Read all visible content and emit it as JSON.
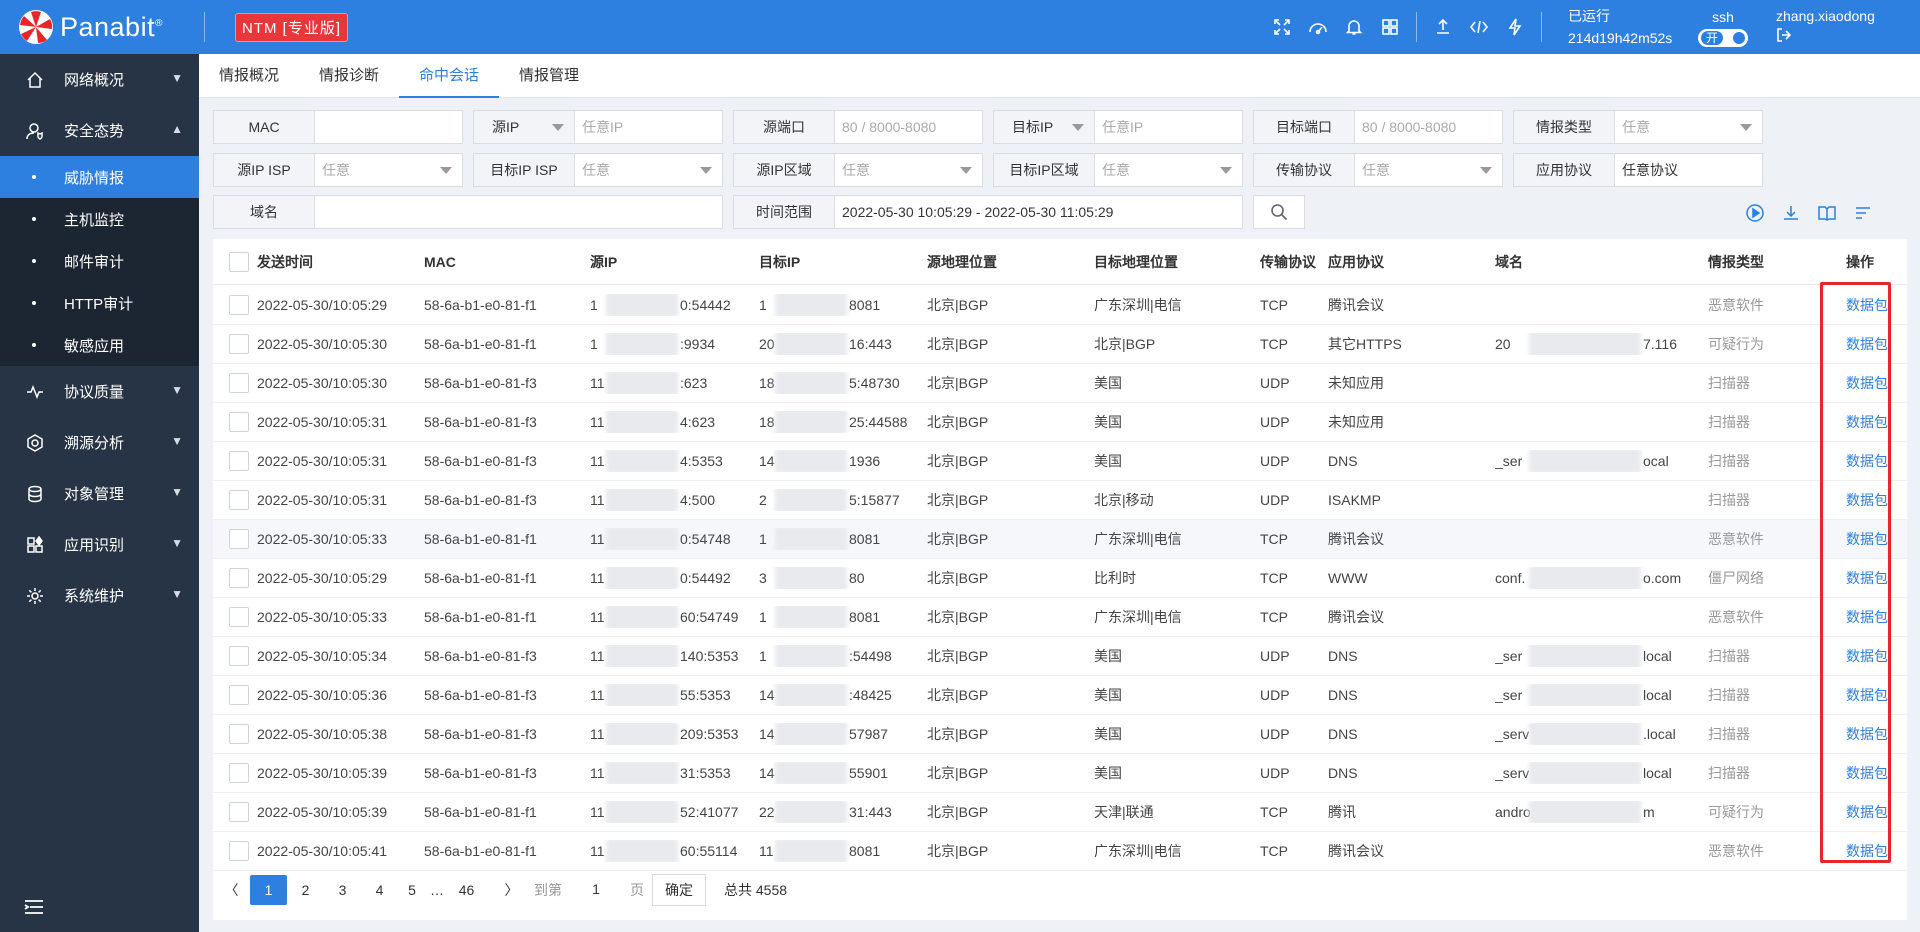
{
  "header": {
    "brand": "Panabit",
    "brand_mark": "®",
    "edition": "NTM [专业版]",
    "runtime_label": "已运行",
    "runtime_value": "214d19h42m52s",
    "ssh_label": "ssh",
    "ssh_toggle": "开",
    "username": "zhang.xiaodong",
    "icons": [
      "fullscreen-icon",
      "dashboard-icon",
      "bell-icon",
      "grid-icon",
      "upload-icon",
      "code-icon",
      "bolt-icon",
      "logout-icon"
    ]
  },
  "sidebar": {
    "items": [
      {
        "label": "网络概况",
        "icon": "home-icon"
      },
      {
        "label": "安全态势",
        "icon": "user-shield-icon"
      },
      {
        "label": "协议质量",
        "icon": "pulse-icon"
      },
      {
        "label": "溯源分析",
        "icon": "target-icon"
      },
      {
        "label": "对象管理",
        "icon": "database-icon"
      },
      {
        "label": "应用识别",
        "icon": "apps-icon"
      },
      {
        "label": "系统维护",
        "icon": "gear-icon"
      }
    ],
    "sub_items": [
      "威胁情报",
      "主机监控",
      "邮件审计",
      "HTTP审计",
      "敏感应用"
    ],
    "active_sub": "威胁情报"
  },
  "tabs": [
    "情报概况",
    "情报诊断",
    "命中会话",
    "情报管理"
  ],
  "active_tab": "命中会话",
  "filters": {
    "mac_label": "MAC",
    "src_ip_label": "源IP",
    "src_ip_placeholder": "任意IP",
    "src_port_label": "源端口",
    "src_port_placeholder": "80 / 8000-8080",
    "dst_ip_label": "目标IP",
    "dst_ip_placeholder": "任意IP",
    "dst_port_label": "目标端口",
    "dst_port_placeholder": "80 / 8000-8080",
    "intel_type_label": "情报类型",
    "intel_type_value": "任意",
    "src_isp_label": "源IP ISP",
    "src_isp_value": "任意",
    "dst_isp_label": "目标IP ISP",
    "dst_isp_value": "任意",
    "src_region_label": "源IP区域",
    "src_region_value": "任意",
    "dst_region_label": "目标IP区域",
    "dst_region_value": "任意",
    "transport_label": "传输协议",
    "transport_value": "任意",
    "app_label": "应用协议",
    "app_placeholder": "任意协议",
    "domain_label": "域名",
    "time_label": "时间范围",
    "time_value": "2022-05-30 10:05:29 - 2022-05-30 11:05:29"
  },
  "table": {
    "columns": [
      "发送时间",
      "MAC",
      "源IP",
      "目标IP",
      "源地理位置",
      "目标地理位置",
      "传输协议",
      "应用协议",
      "域名",
      "情报类型",
      "操作"
    ],
    "rows": [
      {
        "time": "2022-05-30/10:05:29",
        "mac": "58-6a-b1-e0-81-f1",
        "src": "1",
        "src_tail": "0:54442",
        "dst": "1",
        "dst_tail": "8081",
        "src_geo": "北京|BGP",
        "dst_geo": "广东深圳|电信",
        "proto": "TCP",
        "app": "腾讯会议",
        "domain": "",
        "domain_tail": "",
        "type": "恶意软件",
        "action": "数据包"
      },
      {
        "time": "2022-05-30/10:05:30",
        "mac": "58-6a-b1-e0-81-f1",
        "src": "1",
        "src_tail": ":9934",
        "dst": "20",
        "dst_tail": "16:443",
        "src_geo": "北京|BGP",
        "dst_geo": "北京|BGP",
        "proto": "TCP",
        "app": "其它HTTPS",
        "domain": "20",
        "domain_tail": "7.116",
        "type": "可疑行为",
        "action": "数据包"
      },
      {
        "time": "2022-05-30/10:05:30",
        "mac": "58-6a-b1-e0-81-f3",
        "src": "11",
        "src_tail": ":623",
        "dst": "18",
        "dst_tail": "5:48730",
        "src_geo": "北京|BGP",
        "dst_geo": "美国",
        "proto": "UDP",
        "app": "未知应用",
        "domain": "",
        "domain_tail": "",
        "type": "扫描器",
        "action": "数据包"
      },
      {
        "time": "2022-05-30/10:05:31",
        "mac": "58-6a-b1-e0-81-f3",
        "src": "11",
        "src_tail": "4:623",
        "dst": "18",
        "dst_tail": "25:44588",
        "src_geo": "北京|BGP",
        "dst_geo": "美国",
        "proto": "UDP",
        "app": "未知应用",
        "domain": "",
        "domain_tail": "",
        "type": "扫描器",
        "action": "数据包"
      },
      {
        "time": "2022-05-30/10:05:31",
        "mac": "58-6a-b1-e0-81-f3",
        "src": "11",
        "src_tail": "4:5353",
        "dst": "14",
        "dst_tail": "1936",
        "src_geo": "北京|BGP",
        "dst_geo": "美国",
        "proto": "UDP",
        "app": "DNS",
        "domain": "_ser",
        "domain_tail": "ocal",
        "type": "扫描器",
        "action": "数据包"
      },
      {
        "time": "2022-05-30/10:05:31",
        "mac": "58-6a-b1-e0-81-f3",
        "src": "11",
        "src_tail": "4:500",
        "dst": "2",
        "dst_tail": "5:15877",
        "src_geo": "北京|BGP",
        "dst_geo": "北京|移动",
        "proto": "UDP",
        "app": "ISAKMP",
        "domain": "",
        "domain_tail": "",
        "type": "扫描器",
        "action": "数据包"
      },
      {
        "time": "2022-05-30/10:05:33",
        "mac": "58-6a-b1-e0-81-f1",
        "src": "11",
        "src_tail": "0:54748",
        "dst": "1",
        "dst_tail": "8081",
        "src_geo": "北京|BGP",
        "dst_geo": "广东深圳|电信",
        "proto": "TCP",
        "app": "腾讯会议",
        "domain": "",
        "domain_tail": "",
        "type": "恶意软件",
        "action": "数据包"
      },
      {
        "time": "2022-05-30/10:05:29",
        "mac": "58-6a-b1-e0-81-f1",
        "src": "11",
        "src_tail": "0:54492",
        "dst": "3",
        "dst_tail": "80",
        "src_geo": "北京|BGP",
        "dst_geo": "比利时",
        "proto": "TCP",
        "app": "WWW",
        "domain": "conf.",
        "domain_tail": "o.com",
        "type": "僵尸网络",
        "action": "数据包"
      },
      {
        "time": "2022-05-30/10:05:33",
        "mac": "58-6a-b1-e0-81-f1",
        "src": "11",
        "src_tail": "60:54749",
        "dst": "1",
        "dst_tail": "8081",
        "src_geo": "北京|BGP",
        "dst_geo": "广东深圳|电信",
        "proto": "TCP",
        "app": "腾讯会议",
        "domain": "",
        "domain_tail": "",
        "type": "恶意软件",
        "action": "数据包"
      },
      {
        "time": "2022-05-30/10:05:34",
        "mac": "58-6a-b1-e0-81-f3",
        "src": "11",
        "src_tail": "140:5353",
        "dst": "1",
        "dst_tail": ":54498",
        "src_geo": "北京|BGP",
        "dst_geo": "美国",
        "proto": "UDP",
        "app": "DNS",
        "domain": "_ser",
        "domain_tail": "local",
        "type": "扫描器",
        "action": "数据包"
      },
      {
        "time": "2022-05-30/10:05:36",
        "mac": "58-6a-b1-e0-81-f3",
        "src": "11",
        "src_tail": "55:5353",
        "dst": "14",
        "dst_tail": ":48425",
        "src_geo": "北京|BGP",
        "dst_geo": "美国",
        "proto": "UDP",
        "app": "DNS",
        "domain": "_ser",
        "domain_tail": "local",
        "type": "扫描器",
        "action": "数据包"
      },
      {
        "time": "2022-05-30/10:05:38",
        "mac": "58-6a-b1-e0-81-f3",
        "src": "11",
        "src_tail": "209:5353",
        "dst": "14",
        "dst_tail": "57987",
        "src_geo": "北京|BGP",
        "dst_geo": "美国",
        "proto": "UDP",
        "app": "DNS",
        "domain": "_serv",
        "domain_tail": ".local",
        "type": "扫描器",
        "action": "数据包"
      },
      {
        "time": "2022-05-30/10:05:39",
        "mac": "58-6a-b1-e0-81-f3",
        "src": "11",
        "src_tail": "31:5353",
        "dst": "14",
        "dst_tail": "55901",
        "src_geo": "北京|BGP",
        "dst_geo": "美国",
        "proto": "UDP",
        "app": "DNS",
        "domain": "_serv",
        "domain_tail": "local",
        "type": "扫描器",
        "action": "数据包"
      },
      {
        "time": "2022-05-30/10:05:39",
        "mac": "58-6a-b1-e0-81-f1",
        "src": "11",
        "src_tail": "52:41077",
        "dst": "22",
        "dst_tail": "31:443",
        "src_geo": "北京|BGP",
        "dst_geo": "天津|联通",
        "proto": "TCP",
        "app": "腾讯",
        "domain": "andro",
        "domain_tail": "m",
        "type": "可疑行为",
        "action": "数据包"
      },
      {
        "time": "2022-05-30/10:05:41",
        "mac": "58-6a-b1-e0-81-f1",
        "src": "11",
        "src_tail": "60:55114",
        "dst": "11",
        "dst_tail": "8081",
        "src_geo": "北京|BGP",
        "dst_geo": "广东深圳|电信",
        "proto": "TCP",
        "app": "腾讯会议",
        "domain": "",
        "domain_tail": "",
        "type": "恶意软件",
        "action": "数据包"
      }
    ]
  },
  "pagination": {
    "pages": [
      "1",
      "2",
      "3",
      "4",
      "5"
    ],
    "ellipsis": "…",
    "last": "46",
    "goto_label": "到第",
    "goto_value": "1",
    "page_unit": "页",
    "confirm": "确定",
    "total": "总共 4558"
  },
  "colors": {
    "primary": "#2d7fe0",
    "sidebar": "#273445",
    "badge": "#e8373a",
    "highlight_box": "#e8262a"
  }
}
